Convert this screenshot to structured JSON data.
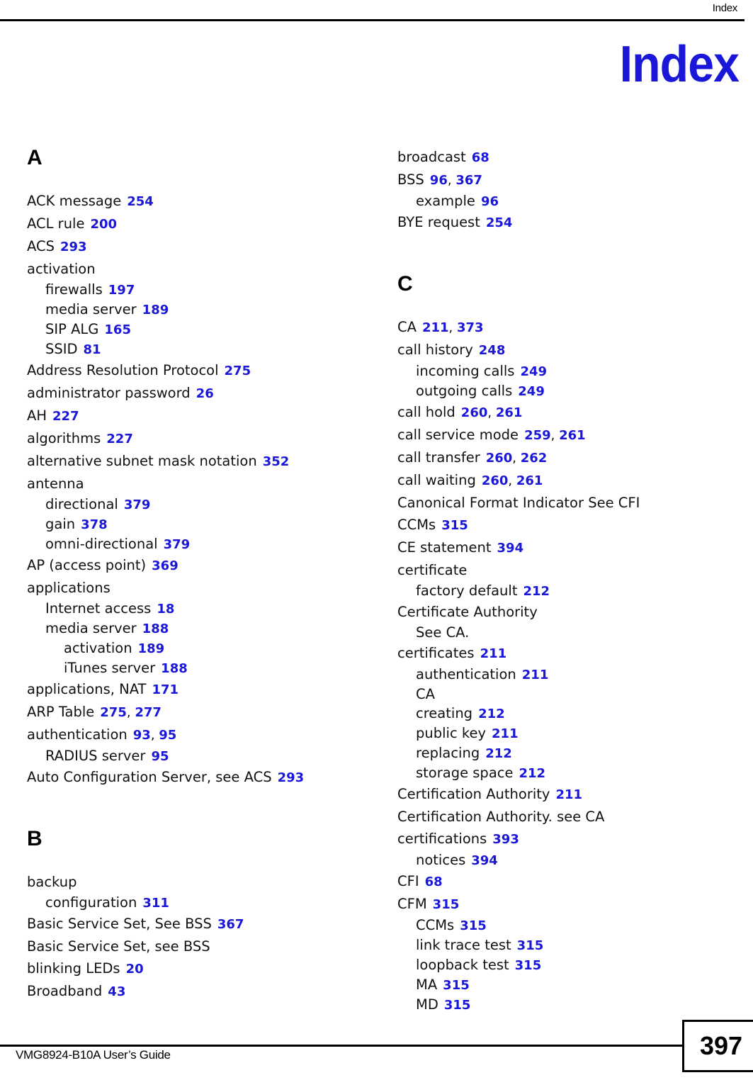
{
  "header": {
    "running_head": "Index"
  },
  "chapter_title": "Index",
  "footer": {
    "guide_name": "VMG8924-B10A User’s Guide",
    "page_number": "397"
  },
  "colors": {
    "page_number_link": "#1A17D8",
    "text": "#111111",
    "title": "#1A17D8"
  },
  "columns": [
    {
      "id": "left",
      "groups": [
        {
          "letter": "A",
          "entries": [
            {
              "level": 1,
              "term": "ACK message",
              "pages": [
                "254"
              ]
            },
            {
              "level": 1,
              "term": "ACL rule",
              "pages": [
                "200"
              ]
            },
            {
              "level": 1,
              "term": "ACS",
              "pages": [
                "293"
              ]
            },
            {
              "level": 1,
              "term": "activation",
              "pages": []
            },
            {
              "level": 2,
              "term": "firewalls",
              "pages": [
                "197"
              ]
            },
            {
              "level": 2,
              "term": "media server",
              "pages": [
                "189"
              ]
            },
            {
              "level": 2,
              "term": "SIP ALG",
              "pages": [
                "165"
              ]
            },
            {
              "level": 2,
              "term": "SSID",
              "pages": [
                "81"
              ]
            },
            {
              "level": 1,
              "term": "Address Resolution Protocol",
              "pages": [
                "275"
              ]
            },
            {
              "level": 1,
              "term": "administrator password",
              "pages": [
                "26"
              ]
            },
            {
              "level": 1,
              "term": "AH",
              "pages": [
                "227"
              ]
            },
            {
              "level": 1,
              "term": "algorithms",
              "pages": [
                "227"
              ]
            },
            {
              "level": 1,
              "term": "alternative subnet mask notation",
              "pages": [
                "352"
              ]
            },
            {
              "level": 1,
              "term": "antenna",
              "pages": []
            },
            {
              "level": 2,
              "term": "directional",
              "pages": [
                "379"
              ]
            },
            {
              "level": 2,
              "term": "gain",
              "pages": [
                "378"
              ]
            },
            {
              "level": 2,
              "term": "omni-directional",
              "pages": [
                "379"
              ]
            },
            {
              "level": 1,
              "term": "AP (access point)",
              "pages": [
                "369"
              ]
            },
            {
              "level": 1,
              "term": "applications",
              "pages": []
            },
            {
              "level": 2,
              "term": "Internet access",
              "pages": [
                "18"
              ]
            },
            {
              "level": 2,
              "term": "media server",
              "pages": [
                "188"
              ]
            },
            {
              "level": 3,
              "term": "activation",
              "pages": [
                "189"
              ]
            },
            {
              "level": 3,
              "term": "iTunes server",
              "pages": [
                "188"
              ]
            },
            {
              "level": 1,
              "term": "applications, NAT",
              "pages": [
                "171"
              ]
            },
            {
              "level": 1,
              "term": "ARP Table",
              "pages": [
                "275",
                "277"
              ]
            },
            {
              "level": 1,
              "term": "authentication",
              "pages": [
                "93",
                "95"
              ]
            },
            {
              "level": 2,
              "term": "RADIUS server",
              "pages": [
                "95"
              ]
            },
            {
              "level": 1,
              "term": "Auto Configuration Server, see ACS",
              "pages": [
                "293"
              ]
            }
          ]
        },
        {
          "letter": "B",
          "entries": [
            {
              "level": 1,
              "term": "backup",
              "pages": []
            },
            {
              "level": 2,
              "term": "configuration",
              "pages": [
                "311"
              ]
            },
            {
              "level": 1,
              "term": "Basic Service Set, See BSS",
              "pages": [
                "367"
              ]
            },
            {
              "level": 1,
              "term": "Basic Service Set, see BSS",
              "pages": []
            },
            {
              "level": 1,
              "term": "blinking LEDs",
              "pages": [
                "20"
              ]
            },
            {
              "level": 1,
              "term": "Broadband",
              "pages": [
                "43"
              ]
            }
          ]
        }
      ]
    },
    {
      "id": "right",
      "groups": [
        {
          "letter": "",
          "entries": [
            {
              "level": 1,
              "term": "broadcast",
              "pages": [
                "68"
              ]
            },
            {
              "level": 1,
              "term": "BSS",
              "pages": [
                "96",
                "367"
              ]
            },
            {
              "level": 2,
              "term": "example",
              "pages": [
                "96"
              ]
            },
            {
              "level": 1,
              "term": "BYE request",
              "pages": [
                "254"
              ]
            }
          ]
        },
        {
          "letter": "C",
          "entries": [
            {
              "level": 1,
              "term": "CA",
              "pages": [
                "211",
                "373"
              ]
            },
            {
              "level": 1,
              "term": "call history",
              "pages": [
                "248"
              ]
            },
            {
              "level": 2,
              "term": "incoming calls",
              "pages": [
                "249"
              ]
            },
            {
              "level": 2,
              "term": "outgoing calls",
              "pages": [
                "249"
              ]
            },
            {
              "level": 1,
              "term": "call hold",
              "pages": [
                "260",
                "261"
              ]
            },
            {
              "level": 1,
              "term": "call service mode",
              "pages": [
                "259",
                "261"
              ]
            },
            {
              "level": 1,
              "term": "call transfer",
              "pages": [
                "260",
                "262"
              ]
            },
            {
              "level": 1,
              "term": "call waiting",
              "pages": [
                "260",
                "261"
              ]
            },
            {
              "level": 1,
              "term": "Canonical Format Indicator See CFI",
              "pages": []
            },
            {
              "level": 1,
              "term": "CCMs",
              "pages": [
                "315"
              ]
            },
            {
              "level": 1,
              "term": "CE statement",
              "pages": [
                "394"
              ]
            },
            {
              "level": 1,
              "term": "certificate",
              "pages": []
            },
            {
              "level": 2,
              "term": "factory default",
              "pages": [
                "212"
              ]
            },
            {
              "level": 1,
              "term": "Certificate Authority",
              "pages": []
            },
            {
              "level": 2,
              "term": "See CA.",
              "pages": []
            },
            {
              "level": 1,
              "term": "certificates",
              "pages": [
                "211"
              ]
            },
            {
              "level": 2,
              "term": "authentication",
              "pages": [
                "211"
              ]
            },
            {
              "level": 2,
              "term": "CA",
              "pages": []
            },
            {
              "level": 2,
              "term": "creating",
              "pages": [
                "212"
              ]
            },
            {
              "level": 2,
              "term": "public key",
              "pages": [
                "211"
              ]
            },
            {
              "level": 2,
              "term": "replacing",
              "pages": [
                "212"
              ]
            },
            {
              "level": 2,
              "term": "storage space",
              "pages": [
                "212"
              ]
            },
            {
              "level": 1,
              "term": "Certification Authority",
              "pages": [
                "211"
              ]
            },
            {
              "level": 1,
              "term": "Certification Authority. see CA",
              "pages": []
            },
            {
              "level": 1,
              "term": "certifications",
              "pages": [
                "393"
              ]
            },
            {
              "level": 2,
              "term": "notices",
              "pages": [
                "394"
              ]
            },
            {
              "level": 1,
              "term": "CFI",
              "pages": [
                "68"
              ]
            },
            {
              "level": 1,
              "term": "CFM",
              "pages": [
                "315"
              ]
            },
            {
              "level": 2,
              "term": "CCMs",
              "pages": [
                "315"
              ]
            },
            {
              "level": 2,
              "term": "link trace test",
              "pages": [
                "315"
              ]
            },
            {
              "level": 2,
              "term": "loopback test",
              "pages": [
                "315"
              ]
            },
            {
              "level": 2,
              "term": "MA",
              "pages": [
                "315"
              ]
            },
            {
              "level": 2,
              "term": "MD",
              "pages": [
                "315"
              ]
            }
          ]
        }
      ]
    }
  ]
}
